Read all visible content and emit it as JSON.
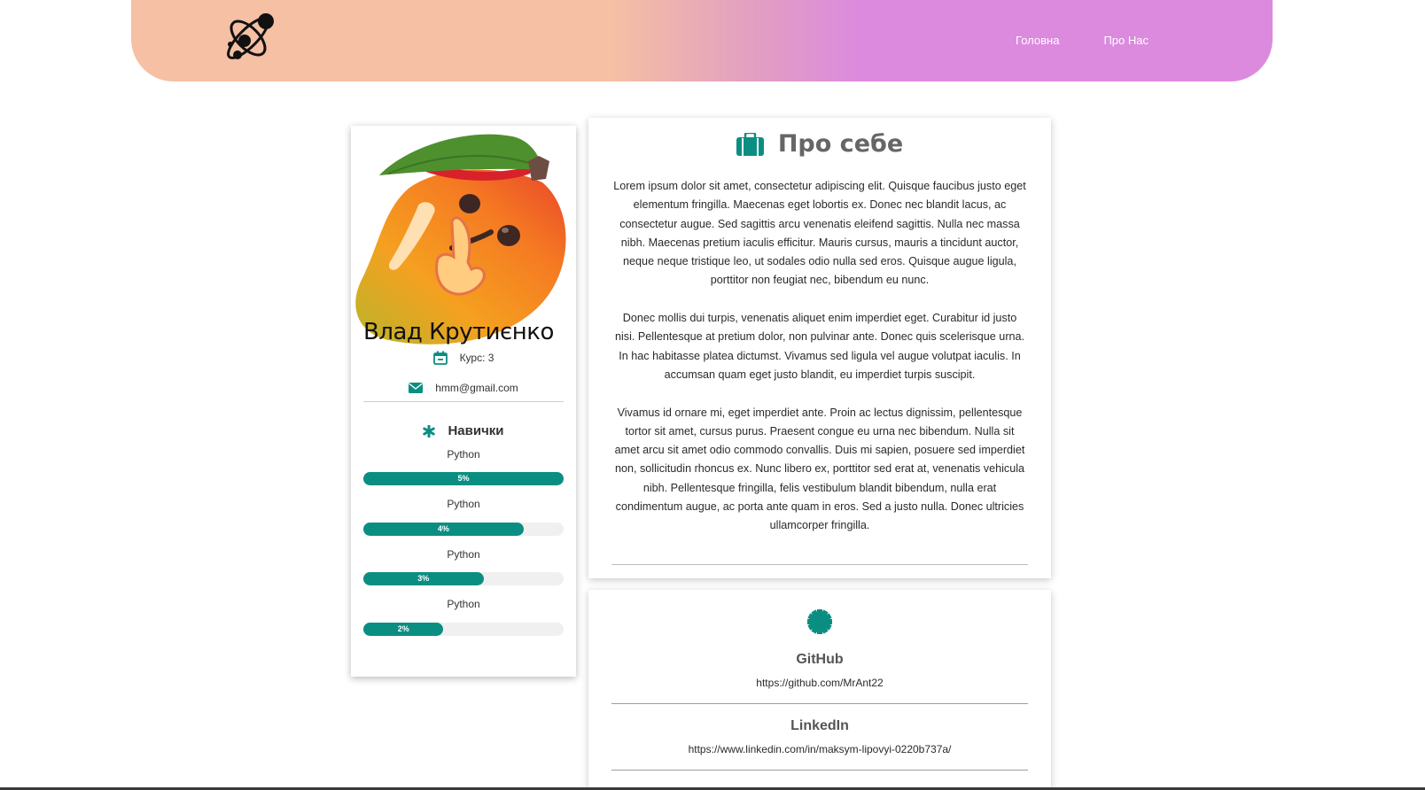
{
  "colors": {
    "accent": "#0b8e82",
    "header_left": "#f5c0a3",
    "header_right": "#db8ade"
  },
  "header": {
    "logo_icon": "atom-icon",
    "nav": [
      {
        "label": "Головна"
      },
      {
        "label": "Про Нас"
      }
    ]
  },
  "profile": {
    "avatar": "mango-shush-avatar",
    "name": "Влад Крутиєнко",
    "course": {
      "icon": "calendar-icon",
      "text": "Курс: 3"
    },
    "email": {
      "icon": "envelope-icon",
      "text": "hmm@gmail.com"
    },
    "skills_title": "Навички",
    "skills_icon": "asterisk-icon",
    "skills": [
      {
        "name": "Python",
        "percent_label": "5%",
        "fill_fraction": 1.0
      },
      {
        "name": "Python",
        "percent_label": "4%",
        "fill_fraction": 0.8
      },
      {
        "name": "Python",
        "percent_label": "3%",
        "fill_fraction": 0.6
      },
      {
        "name": "Python",
        "percent_label": "2%",
        "fill_fraction": 0.4
      }
    ]
  },
  "about": {
    "icon": "briefcase-icon",
    "title": "Про себе",
    "paragraphs": [
      "Lorem ipsum dolor sit amet, consectetur adipiscing elit. Quisque faucibus justo eget elementum fringilla. Maecenas eget lobortis ex. Donec nec blandit lacus, ac consectetur augue. Sed sagittis arcu venenatis eleifend sagittis. Nulla nec massa nibh. Maecenas pretium iaculis efficitur. Mauris cursus, mauris a tincidunt auctor, neque neque tristique leo, ut sodales odio nulla sed eros. Quisque augue ligula, porttitor non feugiat nec, bibendum eu nunc.",
      "Donec mollis dui turpis, venenatis aliquet enim imperdiet eget. Curabitur id justo nisi. Pellentesque at pretium dolor, non pulvinar ante. Donec quis scelerisque urna. In hac habitasse platea dictumst. Vivamus sed ligula vel augue volutpat iaculis. In accumsan quam eget justo blandit, eu imperdiet turpis suscipit.",
      "Vivamus id ornare mi, eget imperdiet ante. Proin ac lectus dignissim, pellentesque tortor sit amet, cursus purus. Praesent congue eu urna nec bibendum. Nulla sit amet arcu sit amet odio commodo convallis. Duis mi sapien, posuere sed imperdiet non, sollicitudin rhoncus ex. Nunc libero ex, porttitor sed erat at, venenatis vehicula nibh. Pellentesque fringilla, felis vestibulum blandit bibendum, nulla erat condimentum augue, ac porta ante quam in eros. Sed a justo nulla. Donec ultricies ullamcorper fringilla."
    ]
  },
  "social": {
    "icon": "badge-gear-icon",
    "links": [
      {
        "name": "GitHub",
        "url": "https://github.com/MrAnt22"
      },
      {
        "name": "LinkedIn",
        "url": "https://www.linkedin.com/in/maksym-lipovyi-0220b737a/"
      }
    ]
  }
}
